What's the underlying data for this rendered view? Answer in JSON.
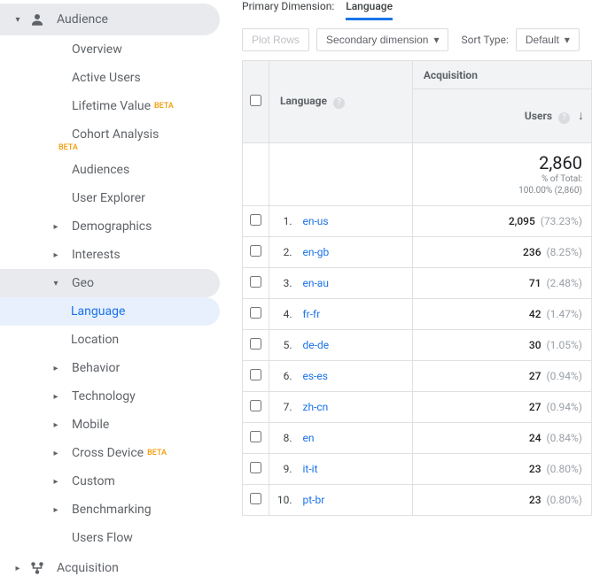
{
  "sidebar": {
    "audience": {
      "label": "Audience",
      "items": [
        {
          "label": "Overview"
        },
        {
          "label": "Active Users"
        },
        {
          "label": "Lifetime Value",
          "beta": "BETA"
        },
        {
          "label": "Cohort Analysis",
          "beta_below": "BETA"
        },
        {
          "label": "Audiences"
        },
        {
          "label": "User Explorer"
        },
        {
          "label": "Demographics",
          "expandable": true
        },
        {
          "label": "Interests",
          "expandable": true
        },
        {
          "label": "Geo",
          "expandable": true,
          "expanded": true,
          "children": [
            {
              "label": "Language",
              "selected": true
            },
            {
              "label": "Location"
            }
          ]
        },
        {
          "label": "Behavior",
          "expandable": true
        },
        {
          "label": "Technology",
          "expandable": true
        },
        {
          "label": "Mobile",
          "expandable": true
        },
        {
          "label": "Cross Device",
          "expandable": true,
          "beta": "BETA"
        },
        {
          "label": "Custom",
          "expandable": true
        },
        {
          "label": "Benchmarking",
          "expandable": true
        },
        {
          "label": "Users Flow"
        }
      ]
    },
    "acquisition": {
      "label": "Acquisition"
    }
  },
  "primaryDimension": {
    "label": "Primary Dimension:",
    "value": "Language"
  },
  "controls": {
    "plotRows": "Plot Rows",
    "secondaryDim": "Secondary dimension",
    "sortTypeLabel": "Sort Type:",
    "sortTypeValue": "Default"
  },
  "table": {
    "langHeader": "Language",
    "acqHeader": "Acquisition",
    "usersHeader": "Users",
    "total": {
      "value": "2,860",
      "sub1": "% of Total:",
      "sub2": "100.00% (2,860)"
    },
    "rows": [
      {
        "idx": "1.",
        "lang": "en-us",
        "users": "2,095",
        "pct": "(73.23%)"
      },
      {
        "idx": "2.",
        "lang": "en-gb",
        "users": "236",
        "pct": "(8.25%)"
      },
      {
        "idx": "3.",
        "lang": "en-au",
        "users": "71",
        "pct": "(2.48%)"
      },
      {
        "idx": "4.",
        "lang": "fr-fr",
        "users": "42",
        "pct": "(1.47%)"
      },
      {
        "idx": "5.",
        "lang": "de-de",
        "users": "30",
        "pct": "(1.05%)"
      },
      {
        "idx": "6.",
        "lang": "es-es",
        "users": "27",
        "pct": "(0.94%)"
      },
      {
        "idx": "7.",
        "lang": "zh-cn",
        "users": "27",
        "pct": "(0.94%)"
      },
      {
        "idx": "8.",
        "lang": "en",
        "users": "24",
        "pct": "(0.84%)"
      },
      {
        "idx": "9.",
        "lang": "it-it",
        "users": "23",
        "pct": "(0.80%)"
      },
      {
        "idx": "10.",
        "lang": "pt-br",
        "users": "23",
        "pct": "(0.80%)"
      }
    ]
  }
}
